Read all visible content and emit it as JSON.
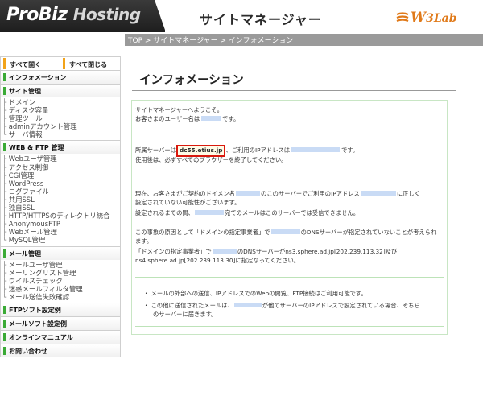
{
  "header": {
    "logo_main": "ProBiz",
    "logo_accent": "Hosting",
    "site_title": "サイトマネージャー",
    "partner_logo_big": "W",
    "partner_logo_rest": "3Lab"
  },
  "breadcrumb": "TOP > サイトマネージャー > インフォメーション",
  "sidebar": {
    "open_all": "すべて開く",
    "close_all": "すべて閉じる",
    "sections": [
      {
        "label": "インフォメーション",
        "items": []
      },
      {
        "label": "サイト管理",
        "items": [
          "ドメイン",
          "ディスク容量",
          "管理ツール",
          "adminアカウント管理",
          "サーバ情報"
        ]
      },
      {
        "label": "WEB & FTP 管理",
        "items": [
          "Webユーザ管理",
          "アクセス制御",
          "CGI管理",
          "WordPress",
          "ログファイル",
          "共用SSL",
          "独自SSL",
          "HTTP/HTTPSのディレクトリ統合",
          "AnonymousFTP",
          "Webメール管理",
          "MySQL管理"
        ]
      },
      {
        "label": "メール管理",
        "items": [
          "メールユーザ管理",
          "メーリングリスト管理",
          "ウイルスチェック",
          "迷惑メールフィルタ管理",
          "メール送信失敗確認"
        ]
      },
      {
        "label": "FTPソフト設定例",
        "items": []
      },
      {
        "label": "メールソフト設定例",
        "items": []
      },
      {
        "label": "オンラインマニュアル",
        "items": []
      },
      {
        "label": "お問い合わせ",
        "items": []
      }
    ]
  },
  "main": {
    "title": "インフォメーション",
    "welcome": "サイトマネージャーへようこそ。",
    "user_prefix": "お客さまのユーザー名は",
    "user_value": "",
    "user_suffix": "です。",
    "server_prefix": "所属サーバーは",
    "server_value": "dc55.etius.jp",
    "server_mid": "、ご利用のIPアドレスは",
    "ip_value": "",
    "server_suffix": "です。",
    "logout_note": "使用後は、必ずすべてのブラウザーを終了してください。",
    "para2_line1_a": "現在、お客さまがご契約のドイメン名",
    "para2_line1_b": "のこのサーバーでご利用のIPアドレス",
    "para2_line1_c": "に正しく",
    "para2_line2": "設定されていない可能性がございます。",
    "para2_line3_a": "設定されるまでの間、",
    "para2_line3_b": "宛てのメールはこのサーバーでは受信できません。",
    "para3_line1_a": "この事象の原因として「ドメインの指定事業者」で",
    "para3_line1_b": "のDNSサーバーが指定されていないことが考えられ",
    "para3_line2": "ます。",
    "para3_line3_a": "「ドメインの指定事業者」で",
    "para3_line3_b": "のDNSサーバーがns3.sphere.ad.jp[202.239.113.32]及び",
    "para3_line4": "ns4.sphere.ad.jp[202.239.113.30]に指定なってください。",
    "bullet1": "メールの外部への送信、IPアドレスでのWebの閲覧、FTP接続はご利用可能です。",
    "bullet2_a": "この他に送信されたメールは、",
    "bullet2_b": "が他のサーバーのIPアドレスで設定されている場合、そちら",
    "bullet2_c": "のサーバーに届きます。"
  },
  "colors": {
    "accent_green": "#3aaa35",
    "highlight_box": "#d9180d",
    "link_blue": "#5b86d8",
    "w3lab_orange": "#e07a1a"
  }
}
